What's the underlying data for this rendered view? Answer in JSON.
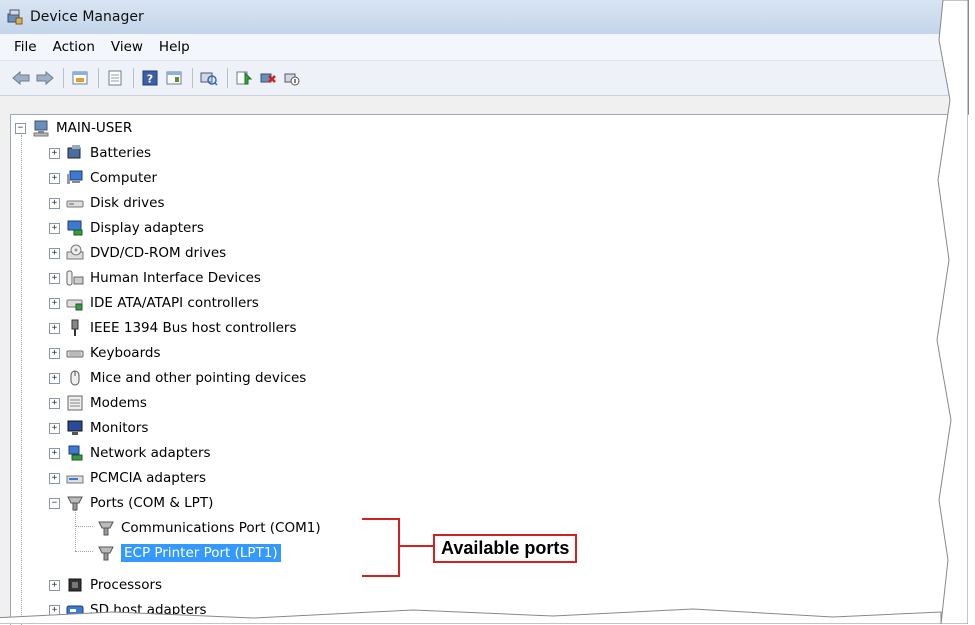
{
  "window": {
    "title": "Device Manager",
    "menu": [
      "File",
      "Action",
      "View",
      "Help"
    ],
    "toolbar_icons": [
      "back-icon",
      "forward-icon",
      "sep",
      "properties-icon",
      "sep",
      "show-hide-console-tree-icon",
      "sep",
      "help-icon",
      "console-view-icon",
      "sep",
      "scan-hardware-icon",
      "sep",
      "update-driver-icon",
      "uninstall-icon",
      "disable-icon"
    ]
  },
  "tree": {
    "root": "MAIN-USER",
    "items": [
      {
        "label": "Batteries",
        "icon": "battery-icon"
      },
      {
        "label": "Computer",
        "icon": "computer-icon"
      },
      {
        "label": "Disk drives",
        "icon": "disk-drive-icon"
      },
      {
        "label": "Display adapters",
        "icon": "display-adapter-icon"
      },
      {
        "label": "DVD/CD-ROM drives",
        "icon": "dvd-drive-icon"
      },
      {
        "label": "Human Interface Devices",
        "icon": "hid-icon"
      },
      {
        "label": "IDE ATA/ATAPI controllers",
        "icon": "ide-controller-icon"
      },
      {
        "label": "IEEE 1394 Bus host controllers",
        "icon": "ieee1394-icon"
      },
      {
        "label": "Keyboards",
        "icon": "keyboard-icon"
      },
      {
        "label": "Mice and other pointing devices",
        "icon": "mouse-icon"
      },
      {
        "label": "Modems",
        "icon": "modem-icon"
      },
      {
        "label": "Monitors",
        "icon": "monitor-icon"
      },
      {
        "label": "Network adapters",
        "icon": "network-adapter-icon"
      },
      {
        "label": "PCMCIA adapters",
        "icon": "pcmcia-icon"
      },
      {
        "label": "Ports (COM & LPT)",
        "icon": "port-icon",
        "expanded": true,
        "children": [
          {
            "label": "Communications Port (COM1)",
            "icon": "port-icon"
          },
          {
            "label": "ECP Printer Port (LPT1)",
            "icon": "port-icon",
            "selected": true
          }
        ]
      },
      {
        "label": "Processors",
        "icon": "processor-icon"
      },
      {
        "label": "SD host adapters",
        "icon": "sd-adapter-icon"
      }
    ]
  },
  "callout": {
    "text": "Available ports",
    "color": "#d42020"
  },
  "colors": {
    "selection": "#3399ff",
    "callout": "#d42020"
  }
}
